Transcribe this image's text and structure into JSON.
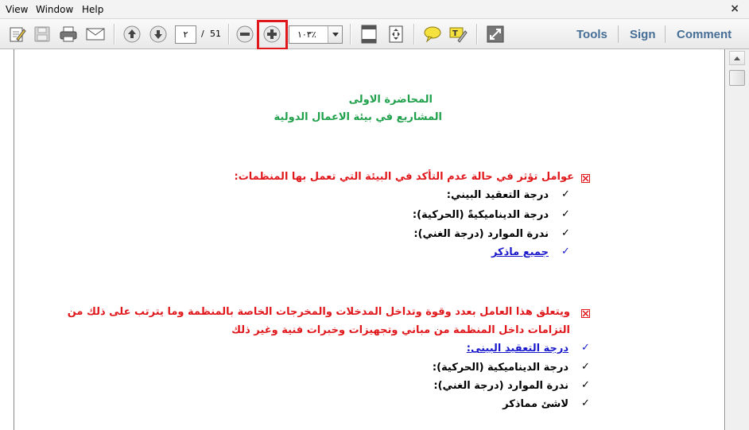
{
  "menu": {
    "view": "View",
    "window": "Window",
    "help": "Help",
    "close": "×"
  },
  "toolbar": {
    "page_current": "٢",
    "page_separator": "/",
    "page_total": "51",
    "zoom": "١٠٣٪",
    "tools": "Tools",
    "sign": "Sign",
    "comment": "Comment",
    "icons": [
      "edit-icon",
      "save-icon",
      "print-icon",
      "email-icon",
      "page-up-icon",
      "page-down-icon",
      "zoom-out-icon",
      "zoom-in-icon",
      "fit-page-icon",
      "fit-width-icon",
      "sticky-note-icon",
      "highlight-text-icon",
      "fullscreen-icon"
    ],
    "highlight_color": "#e0171b"
  },
  "document": {
    "title": "المحاضرة الاولى",
    "subtitle": "المشاريع في بيئة الاعمال الدولية",
    "section1": {
      "heading": "عوامل تؤثر في حالة عدم التأكد في البيئة التي تعمل بها المنظمات:",
      "items": [
        "درجة التعقيد البيني:",
        "درجة الديناميكيةً (الحركية):",
        "ندرة الموارد (درجة الغني):",
        "جميع ماذكر"
      ]
    },
    "section2": {
      "heading_line1": "ويتعلق هذا العامل بعدد وقوة وتداخل المدخلات والمخرجات الخاصة بالمنظمة وما يترتب على ذلك من",
      "heading_line2": "التزامات داخل المنظمة من مباني وتجهيزات وخبرات فنية وغير ذلك",
      "items": [
        "درجة التعقيد البينى:",
        "درجة الديناميكية (الحركية):",
        "ندرة الموارد (درجة الغني):",
        "لاشئ مماذكر"
      ]
    },
    "colors": {
      "title": "#1fa04a",
      "heading": "#e0171b",
      "link": "#1a1acc"
    }
  }
}
